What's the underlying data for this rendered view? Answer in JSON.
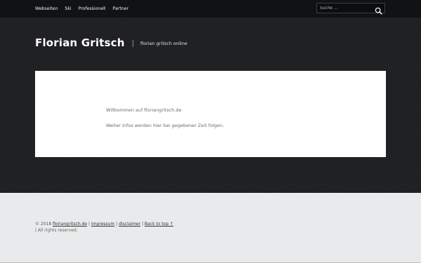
{
  "nav": {
    "items": [
      {
        "label": "Webseiten"
      },
      {
        "label": "Ski"
      },
      {
        "label": "Professionell"
      },
      {
        "label": "Partner"
      }
    ]
  },
  "search": {
    "placeholder": "Suche …",
    "icon": "search-icon"
  },
  "header": {
    "title": "Florian Gritsch",
    "tagline": "florian gritsch online"
  },
  "content": {
    "paragraph1": "Willkommen auf floriangritsch.de",
    "paragraph2": "Weiter Infos werden hier bei gegebener Zeit folgen."
  },
  "footer": {
    "copyright_prefix": "© 2018",
    "site_link": "floriangritsch.de",
    "separator": "|",
    "impressum": "Impressum",
    "disclaimer": "disclaimer",
    "back_to_top": "Back to top ↑",
    "rights": "| All rights reserved."
  },
  "colors": {
    "topbar": "#111214",
    "hero": "#1f2022",
    "card": "#ffffff",
    "footer": "#e9eaeb"
  }
}
